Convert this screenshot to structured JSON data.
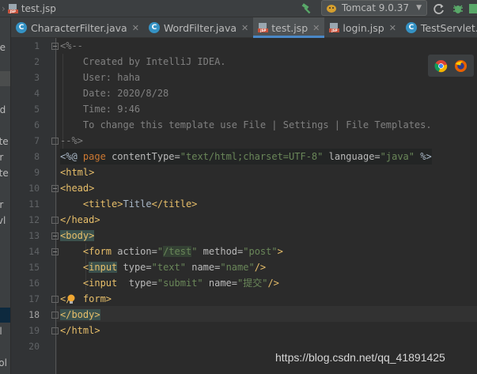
{
  "breadcrumb": {
    "file": "test.jsp"
  },
  "toolbar": {
    "run_config": "Tomcat 9.0.37"
  },
  "tabs": [
    {
      "label": "CharacterFilter.java",
      "type": "java"
    },
    {
      "label": "WordFilter.java",
      "type": "java"
    },
    {
      "label": "test.jsp",
      "type": "jsp",
      "active": true
    },
    {
      "label": "login.jsp",
      "type": "jsp"
    },
    {
      "label": "TestServlet.ja",
      "type": "java"
    }
  ],
  "project_panel": {
    "items": [
      "de",
      "nd",
      "cte",
      "er",
      "ilte",
      "er",
      "rvl",
      "ol",
      "sol"
    ]
  },
  "editor": {
    "current_line": "18",
    "line_numbers": [
      "1",
      "2",
      "3",
      "4",
      "5",
      "6",
      "7",
      "8",
      "9",
      "10",
      "11",
      "12",
      "13",
      "14",
      "15",
      "16",
      "17",
      "18",
      "19",
      "20"
    ],
    "lines": {
      "l1": "<%--",
      "l2": "    Created by IntelliJ IDEA.",
      "l3": "    User: haha",
      "l4": "    Date: 2020/8/28",
      "l5": "    Time: 9:46",
      "l6": "    To change this template use File | Settings | File Templates.",
      "l7": "--%>",
      "l8": {
        "open": "<%@",
        "page": "page",
        "ct_attr": "contentType=",
        "ct_val": "\"text/html;charset=UTF-8\"",
        "lang_attr": "language=",
        "lang_val": "\"java\"",
        "close": "%>"
      },
      "l9": "<html>",
      "l10": "<head>",
      "l11": {
        "open": "<title>",
        "text": "Title",
        "close": "</title>"
      },
      "l12": "</head>",
      "l13": "<body>",
      "l14": {
        "tag": "<form",
        "a1": "action=",
        "q1": "\"",
        "v1": "/test",
        "q2": "\"",
        "a2": "method=",
        "v2": "\"post\"",
        "end": ">"
      },
      "l15": {
        "tag_lt": "<",
        "tag": "input",
        "a1": "type=",
        "v1": "\"text\"",
        "a2": "name=",
        "v2": "\"name\"",
        "end": "/>"
      },
      "l16": {
        "tag": "<input",
        "a1": "type=",
        "v1": "\"submit\"",
        "a2": "name=",
        "v2": "\"提交\"",
        "end": "/>"
      },
      "l17": {
        "lt": "</",
        "rest": "form>"
      },
      "l18": "</body>",
      "l19": "</html>"
    }
  },
  "watermark": "https://blog.csdn.net/qq_41891425"
}
